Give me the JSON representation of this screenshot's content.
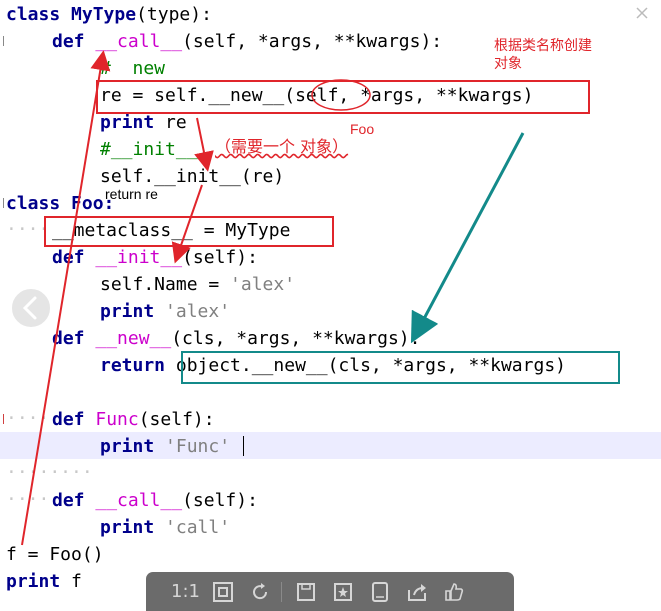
{
  "code_lines": [
    {
      "id": "l1",
      "parts": [
        {
          "t": "class ",
          "c": "kw"
        },
        {
          "t": "MyType",
          "c": "kw"
        },
        {
          "t": "(type):",
          "c": ""
        }
      ]
    },
    {
      "id": "l2",
      "parts": [
        {
          "t": "def ",
          "c": "kw"
        },
        {
          "t": "__call__",
          "c": "fn"
        },
        {
          "t": "(self, *args, **kwargs):",
          "c": ""
        }
      ]
    },
    {
      "id": "l3",
      "parts": [
        {
          "t": "#  new",
          "c": "cm"
        }
      ]
    },
    {
      "id": "l4",
      "parts": [
        {
          "t": "re = self.__new__(self, *args, **kwargs)",
          "c": ""
        }
      ]
    },
    {
      "id": "l5",
      "parts": [
        {
          "t": "print ",
          "c": "kw"
        },
        {
          "t": "re",
          "c": ""
        }
      ]
    },
    {
      "id": "l6",
      "parts": [
        {
          "t": "#__init__",
          "c": "cm"
        }
      ]
    },
    {
      "id": "l7",
      "parts": [
        {
          "t": "self.__init__(re)",
          "c": ""
        }
      ]
    },
    {
      "id": "l8",
      "parts": [
        {
          "t": "class ",
          "c": "kw"
        },
        {
          "t": "Foo:",
          "c": "kw"
        }
      ]
    },
    {
      "id": "l9",
      "parts": [
        {
          "t": "__metaclass__ = MyType",
          "c": ""
        }
      ]
    },
    {
      "id": "l10",
      "parts": [
        {
          "t": "def ",
          "c": "kw"
        },
        {
          "t": "__init__",
          "c": "fn"
        },
        {
          "t": "(self):",
          "c": ""
        }
      ]
    },
    {
      "id": "l11",
      "parts": [
        {
          "t": "self.Name = ",
          "c": ""
        },
        {
          "t": "'alex'",
          "c": "str"
        }
      ]
    },
    {
      "id": "l12",
      "parts": [
        {
          "t": "print ",
          "c": "kw"
        },
        {
          "t": "'alex'",
          "c": "str"
        }
      ]
    },
    {
      "id": "l13",
      "parts": [
        {
          "t": "def ",
          "c": "kw"
        },
        {
          "t": "__new__",
          "c": "fn"
        },
        {
          "t": "(cls, *args, **kwargs):",
          "c": ""
        }
      ]
    },
    {
      "id": "l14",
      "parts": [
        {
          "t": "return ",
          "c": "kw"
        },
        {
          "t": "object.__new__(cls, *args, **kwargs)",
          "c": ""
        }
      ]
    },
    {
      "id": "l15",
      "parts": [
        {
          "t": "def ",
          "c": "kw"
        },
        {
          "t": "Func",
          "c": "fn"
        },
        {
          "t": "(self):",
          "c": ""
        }
      ]
    },
    {
      "id": "l16",
      "parts": [
        {
          "t": "print ",
          "c": "kw"
        },
        {
          "t": "'Func'",
          "c": "str"
        }
      ]
    },
    {
      "id": "l17",
      "parts": [
        {
          "t": "def ",
          "c": "kw"
        },
        {
          "t": "__call__",
          "c": "fn"
        },
        {
          "t": "(self):",
          "c": ""
        }
      ]
    },
    {
      "id": "l18",
      "parts": [
        {
          "t": "print ",
          "c": "kw"
        },
        {
          "t": "'call'",
          "c": "str"
        }
      ]
    },
    {
      "id": "l19",
      "parts": [
        {
          "t": "f = Foo()",
          "c": ""
        }
      ]
    },
    {
      "id": "l20",
      "parts": [
        {
          "t": "print ",
          "c": "kw"
        },
        {
          "t": "f",
          "c": ""
        }
      ]
    }
  ],
  "annotations": {
    "create_by_name": "根据类名称创建\n对象",
    "foo_label": "Foo",
    "need_object": "（需要一个  对象）",
    "return_re": "return re"
  },
  "toolbar": {
    "ratio_label": "1:1",
    "icons": [
      "fit-screen-icon",
      "rotate-icon",
      "save-icon",
      "bookmark-star-icon",
      "tablet-icon",
      "share-icon",
      "like-icon"
    ]
  },
  "colors": {
    "keyword": "#00008b",
    "function": "#cc00cc",
    "string": "#808080",
    "comment": "#008000",
    "annotation_red": "#e0252b",
    "annotation_teal": "#138a8a",
    "current_line": "#ececff",
    "toolbar_bg": "#6b6b6b"
  }
}
